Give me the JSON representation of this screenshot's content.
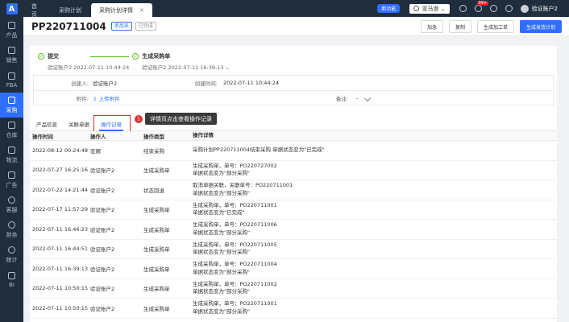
{
  "sidebar": {
    "logo": "A",
    "items": [
      {
        "label": "产品"
      },
      {
        "label": "销售"
      },
      {
        "label": "FBA"
      },
      {
        "label": "采购"
      },
      {
        "label": "仓库"
      },
      {
        "label": "物流"
      },
      {
        "label": "广告"
      },
      {
        "label": "客服"
      },
      {
        "label": "财务"
      },
      {
        "label": "统计"
      },
      {
        "label": "BI"
      }
    ]
  },
  "topbar": {
    "tabs": [
      {
        "label": "首页"
      },
      {
        "label": "采购计划"
      },
      {
        "label": "采购计划详情"
      }
    ],
    "new_feature": "新功能",
    "site": "亚马逊",
    "notification_badge": "99+",
    "user": "验证账户2"
  },
  "header": {
    "plan_id": "PP220711004",
    "tag1": "单品采",
    "tag2": "已完成",
    "buttons": {
      "urgent": "加急",
      "copy": "复制",
      "create_work_order": "生成加工单",
      "create_shipment": "生成发货计划"
    }
  },
  "steps": [
    {
      "title": "提交",
      "sub": "验证账户2 2022-07-11 10:44:24",
      "check": "✓"
    },
    {
      "title": "生成采购单",
      "sub": "验证账户2 2022-07-11 16:39:13 ⌄",
      "check": "✓"
    }
  ],
  "info": {
    "creator_label": "创建人:",
    "creator": "验证账户2",
    "created_label": "创建时间:",
    "created": "2022-07-11 10:44:24",
    "attach_label": "附件:",
    "attach_link": "⇪ 上传附件",
    "remark_label": "备注:",
    "remark": "-"
  },
  "subtabs": {
    "product_info": "产品信息",
    "related_docs": "关联单据",
    "operation_log": "操作记录"
  },
  "callout": {
    "number": "1",
    "text": "详情页点击查看操作记录"
  },
  "table": {
    "headers": [
      "操作时间",
      "操作人",
      "操作类型",
      "操作详情"
    ],
    "rows": [
      {
        "time": "2022-08-12 00:24:48",
        "user": "宏娜",
        "type": "结束采购",
        "detail1": "采购计划PP220711004结束采购 单据状态变为\"已完成\"",
        "detail2": ""
      },
      {
        "time": "2022-07-27 16:25:16",
        "user": "验证账户2",
        "type": "生成采购单",
        "detail1": "生成采购单，单号：PO220727002",
        "detail2": "单据状态变为\"部分采购\""
      },
      {
        "time": "2022-07-22 14:21:44",
        "user": "验证账户2",
        "type": "状态回退",
        "detail1": "取消单据关联，关联单号：PO220711001",
        "detail2": "单据状态变为\"部分采购\""
      },
      {
        "time": "2022-07-17 11:57:29",
        "user": "验证账户2",
        "type": "生成采购单",
        "detail1": "生成采购单，单号：PO220711001",
        "detail2": "单据状态变为\"已完成\""
      },
      {
        "time": "2022-07-11 16:46:23",
        "user": "验证账户2",
        "type": "生成采购单",
        "detail1": "生成采购单，单号：PO220711006",
        "detail2": "单据状态变为\"部分采购\""
      },
      {
        "time": "2022-07-11 16:44:51",
        "user": "验证账户2",
        "type": "生成采购单",
        "detail1": "生成采购单，单号：PO220711005",
        "detail2": "单据状态变为\"部分采购\""
      },
      {
        "time": "2022-07-11 16:39:13",
        "user": "验证账户2",
        "type": "生成采购单",
        "detail1": "生成采购单，单号：PO220711004",
        "detail2": "单据状态变为\"部分采购\""
      },
      {
        "time": "2022-07-11 10:50:15",
        "user": "验证账户2",
        "type": "生成采购单",
        "detail1": "生成采购单，单号：PO220711002",
        "detail2": "单据状态变为\"部分采购\""
      },
      {
        "time": "2022-07-11 10:50:15",
        "user": "验证账户2",
        "type": "生成采购单",
        "detail1": "生成采购单，单号：PO220711001",
        "detail2": "单据状态变为\"部分采购\""
      }
    ]
  }
}
